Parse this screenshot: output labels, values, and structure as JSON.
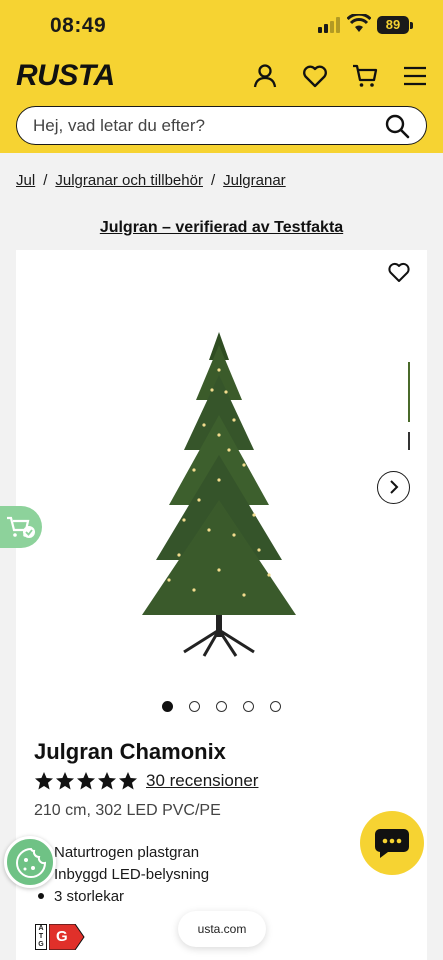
{
  "status_bar": {
    "time": "08:49",
    "battery": "89"
  },
  "header": {
    "logo": "RUSTA",
    "search_placeholder": "Hej, vad letar du efter?"
  },
  "breadcrumb": [
    {
      "label": "Jul"
    },
    {
      "label": "Julgranar och tillbehör"
    },
    {
      "label": "Julgranar"
    }
  ],
  "verification_link": "Julgran – verifierad av Testfakta",
  "product": {
    "title": "Julgran Chamonix",
    "rating": 5,
    "reviews_label": "30 recensioner",
    "variant": "210 cm, 302 LED PVC/PE",
    "features": [
      "Naturtrogen plastgran",
      "Inbyggd LED-belysning",
      "3 storlekar"
    ],
    "energy_label": {
      "atg": "A T G",
      "grade": "G"
    },
    "gallery": {
      "image_count": 5,
      "active_index": 0
    }
  },
  "url_pill": "usta.com",
  "colors": {
    "brand_yellow": "#f6d332",
    "cart_green": "#8dd29b",
    "energy_red": "#e0302a"
  }
}
